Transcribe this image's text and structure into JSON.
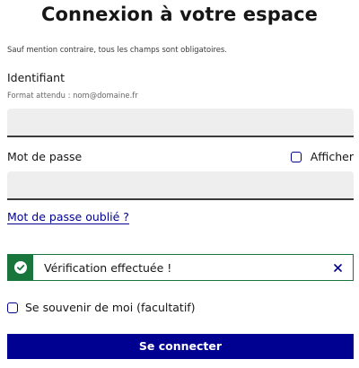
{
  "form": {
    "title": "Connexion à votre espace",
    "mandatory_notice": "Sauf mention contraire, tous les champs sont obligatoires."
  },
  "identifier": {
    "label": "Identifiant",
    "hint": "Format attendu : nom@domaine.fr",
    "value": "",
    "placeholder": ""
  },
  "password": {
    "label": "Mot de passe",
    "show_label": "Afficher",
    "show_checked": false,
    "value": "",
    "placeholder": ""
  },
  "forgot_password": {
    "label": "Mot de passe oublié ?"
  },
  "alert": {
    "text": "Vérification effectuée !",
    "status": "success",
    "icon": "check-circle-icon",
    "close_icon": "close-icon"
  },
  "remember_me": {
    "label": "Se souvenir de moi (facultatif)",
    "checked": false
  },
  "submit": {
    "label": "Se connecter"
  },
  "colors": {
    "brand_blue": "#000091",
    "success_green": "#18753c",
    "input_background": "#eeeeee",
    "text": "#161616"
  }
}
